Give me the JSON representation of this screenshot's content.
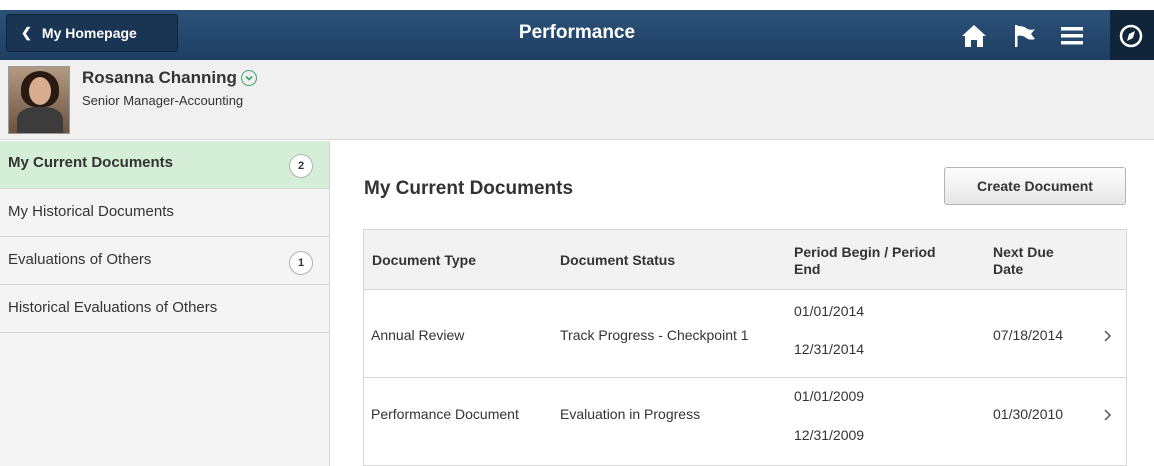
{
  "header": {
    "back_label": "My Homepage",
    "title": "Performance",
    "icons": [
      "home-icon",
      "flag-icon",
      "menu-icon",
      "navbar-compass-icon"
    ]
  },
  "profile": {
    "name": "Rosanna Channing",
    "title": "Senior Manager-Accounting"
  },
  "sidebar": {
    "items": [
      {
        "label": "My Current Documents",
        "count": "2",
        "active": true
      },
      {
        "label": "My Historical Documents",
        "count": "",
        "active": false
      },
      {
        "label": "Evaluations of Others",
        "count": "1",
        "active": false
      },
      {
        "label": "Historical Evaluations of Others",
        "count": "",
        "active": false
      }
    ]
  },
  "main": {
    "title": "My Current Documents",
    "create_button": "Create Document",
    "columns": {
      "type": "Document Type",
      "status": "Document Status",
      "period_line1": "Period Begin / Period",
      "period_line2": "End",
      "due_line1": "Next Due",
      "due_line2": "Date"
    },
    "rows": [
      {
        "type": "Annual Review",
        "status": "Track Progress - Checkpoint 1",
        "begin": "01/01/2014",
        "end": "12/31/2014",
        "due": "07/18/2014"
      },
      {
        "type": "Performance Document",
        "status": "Evaluation in Progress",
        "begin": "01/01/2009",
        "end": "12/31/2009",
        "due": "01/30/2010"
      }
    ]
  },
  "colors": {
    "header_bg": "#2c5178",
    "active_item_bg": "#d5eed8",
    "accent_green": "#3aa36a"
  }
}
